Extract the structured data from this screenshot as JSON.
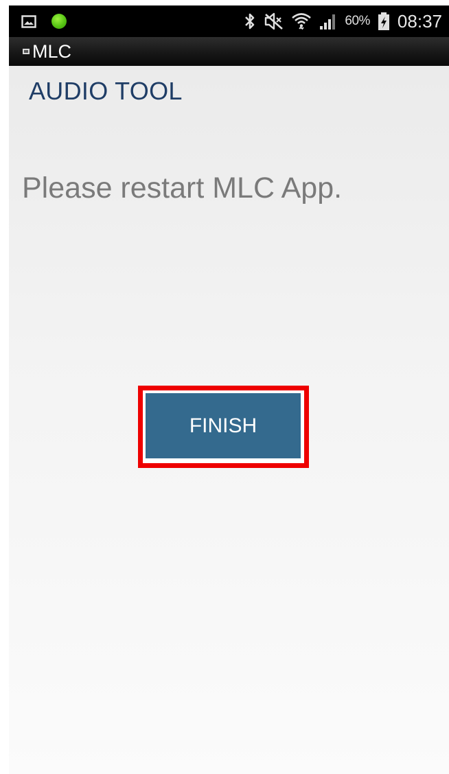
{
  "status_bar": {
    "left_icons": [
      "gallery-icon",
      "green-notification-dot-icon"
    ],
    "right_icons": [
      "bluetooth-icon",
      "muted-icon",
      "wifi-icon",
      "signal-icon",
      "battery-charging-icon"
    ],
    "battery_percent": "60%",
    "time": "08:37"
  },
  "title_bar": {
    "app_name": "MLC"
  },
  "content": {
    "section_title": "AUDIO TOOL",
    "message": "Please restart MLC App.",
    "finish_label": "FINISH"
  },
  "colors": {
    "button": "#346a8e",
    "highlight": "#ee0000",
    "section_title": "#1f3d66"
  }
}
